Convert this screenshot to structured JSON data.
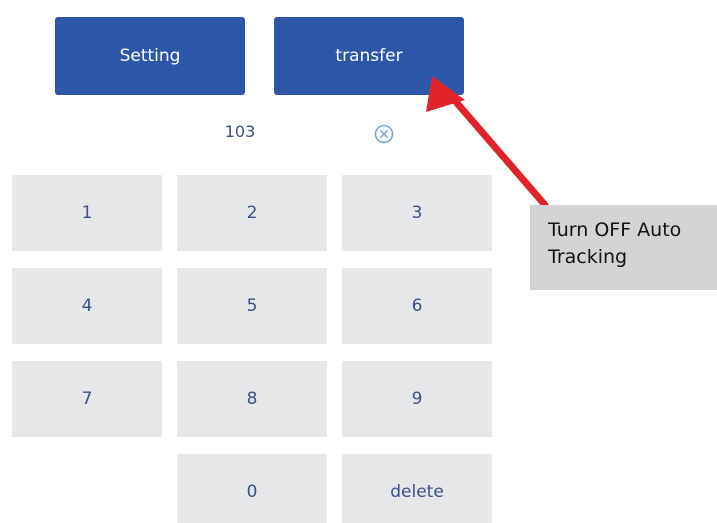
{
  "top_buttons": {
    "setting_label": "Setting",
    "transfer_label": "transfer"
  },
  "display": {
    "value": "103",
    "clear_icon": "circle-x-icon"
  },
  "keypad": {
    "keys": [
      "1",
      "2",
      "3",
      "4",
      "5",
      "6",
      "7",
      "8",
      "9",
      "0",
      "delete"
    ]
  },
  "callout": {
    "line1": "Turn OFF Auto",
    "line2": "Tracking"
  },
  "colors": {
    "button_blue": "#2c56a8",
    "key_gray": "#e6e7e9",
    "key_text": "#3a4f86",
    "arrow_red": "#e0242a",
    "callout_bg": "#d3d4d6"
  }
}
